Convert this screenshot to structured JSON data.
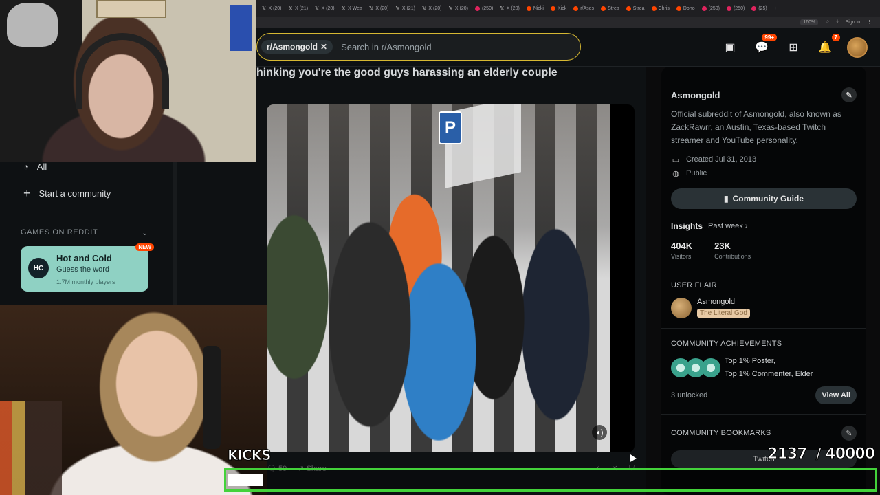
{
  "browser": {
    "tabs": [
      "X (20)",
      "X (21)",
      "X (20)",
      "X Wea",
      "X (20)",
      "X (21)",
      "X (20)",
      "X (20)",
      "(250)",
      "X (20)",
      "Nicki",
      "Kick",
      "r/Ases",
      "Strea",
      "Strea",
      "Chris",
      "Dono",
      "(250)",
      "(250)",
      "(25)"
    ],
    "zoom": "160%",
    "signin_label": "Sign in"
  },
  "header": {
    "community_chip": "r/Asmongold",
    "search_placeholder": "Search in r/Asmongold",
    "chat_badge": "99+",
    "notif_badge": "7"
  },
  "post": {
    "title": "hinking you're the good guys harassing an elderly couple",
    "video_sign": "P",
    "comments": "59",
    "share": "Share"
  },
  "sidebar": {
    "community_name": "Asmongold",
    "description": "Official subreddit of Asmongold, also known as ZackRawrr, an Austin, Texas-based Twitch streamer and YouTube personality.",
    "created": "Created Jul 31, 2013",
    "visibility": "Public",
    "guide_button": "Community Guide",
    "insights_label": "Insights",
    "insights_period": "Past week",
    "stats": [
      {
        "num": "404K",
        "label": "Visitors"
      },
      {
        "num": "23K",
        "label": "Contributions"
      }
    ],
    "user_flair_heading": "USER FLAIR",
    "flair_user": "Asmongold",
    "flair_tag": "The Literal God",
    "achievements_heading": "COMMUNITY ACHIEVEMENTS",
    "achievements_line1": "Top 1% Poster,",
    "achievements_line2": "Top 1% Commenter, Elder",
    "unlocked": "3 unlocked",
    "view_all": "View All",
    "bookmarks_heading": "COMMUNITY BOOKMARKS",
    "bookmark_twitch": "Twitch"
  },
  "leftnav": {
    "all": "All",
    "start_community": "Start a community",
    "games_heading": "GAMES ON REDDIT",
    "game_title": "Hot and Cold",
    "game_subtitle": "Guess the word",
    "game_players": "1.7M monthly players",
    "game_icon": "HC",
    "new_badge": "NEW"
  },
  "overlay": {
    "kicks_label": "KICKS",
    "kicks_count": "2137  / 40000",
    "progress_fraction": 0.053,
    "accent_color": "#43d23a"
  },
  "icons": {
    "search": "search-icon",
    "chat": "chat-icon",
    "create": "plus-icon",
    "notifications": "bell-icon",
    "edit": "pencil-icon",
    "volume": "volume-icon"
  }
}
